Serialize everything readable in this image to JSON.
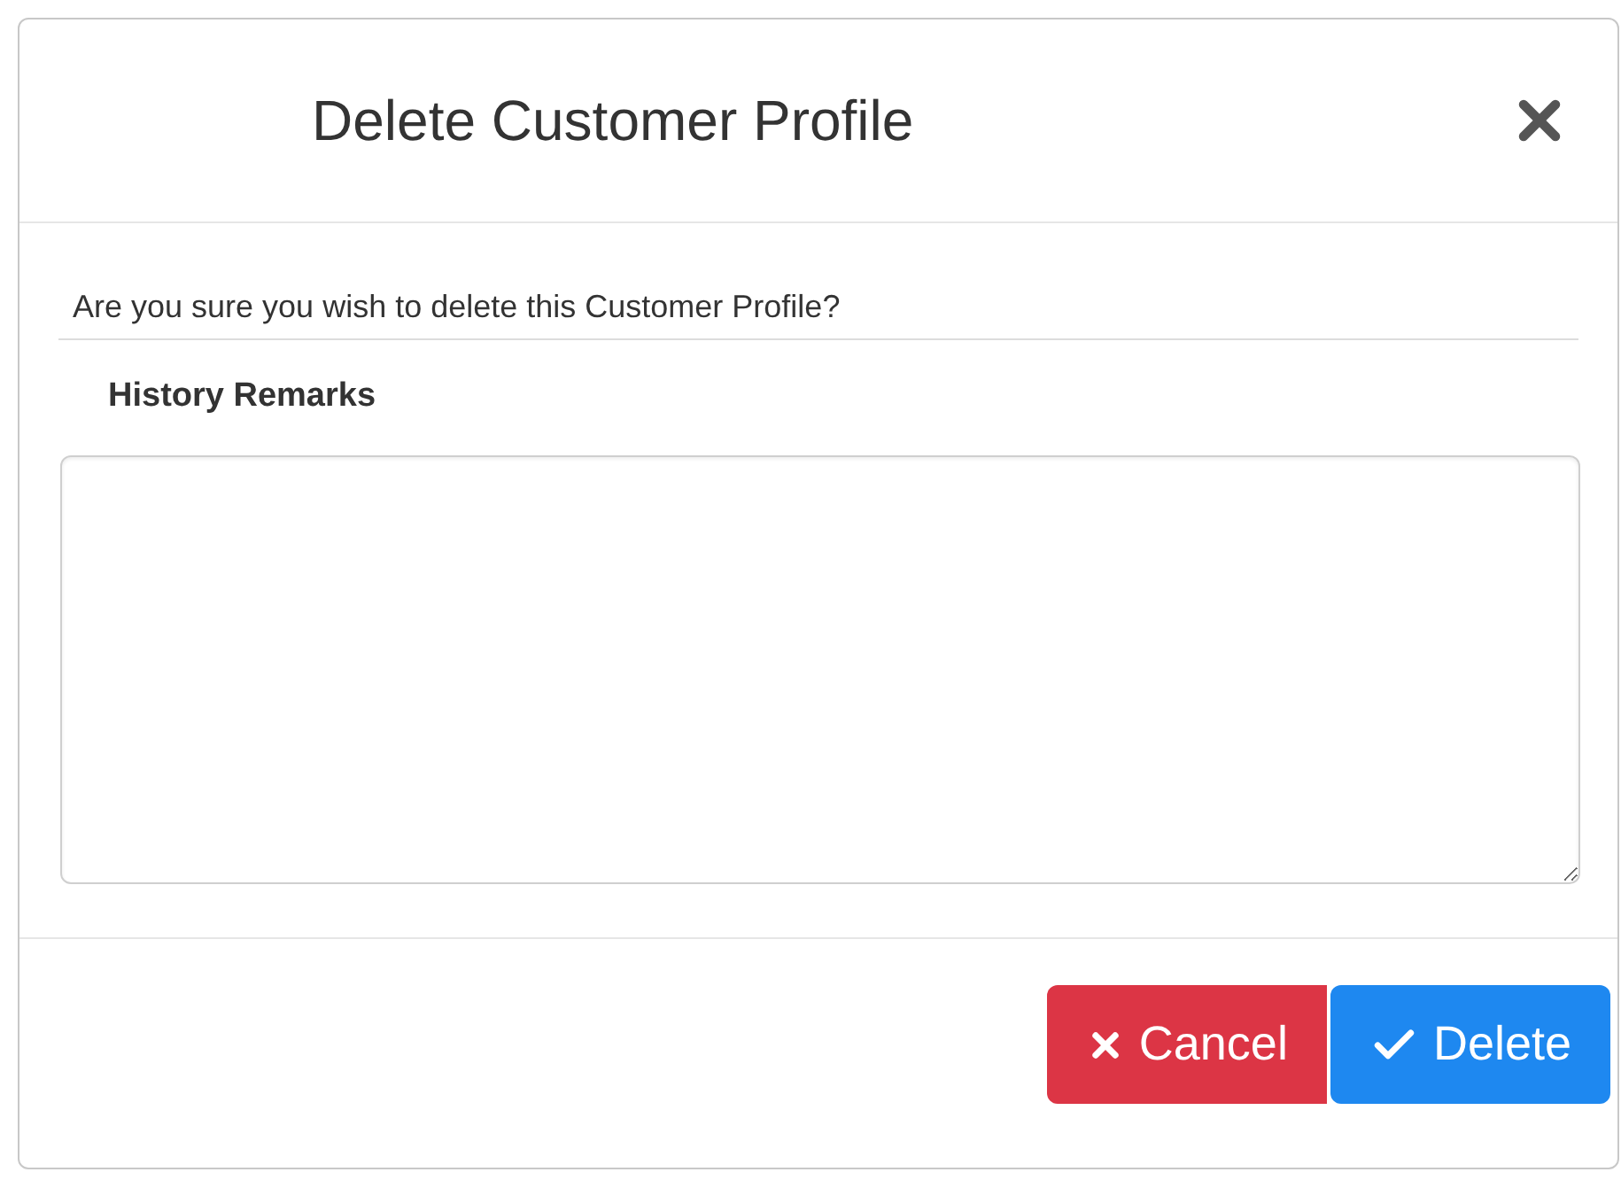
{
  "dialog": {
    "title": "Delete Customer Profile"
  },
  "message": "Are you sure you wish to delete this Customer Profile?",
  "remarks": {
    "label": "History Remarks"
  },
  "buttons": [
    {
      "label": "Cancel",
      "kind": "cancel"
    },
    {
      "label": "Delete",
      "kind": "confirm"
    }
  ]
}
